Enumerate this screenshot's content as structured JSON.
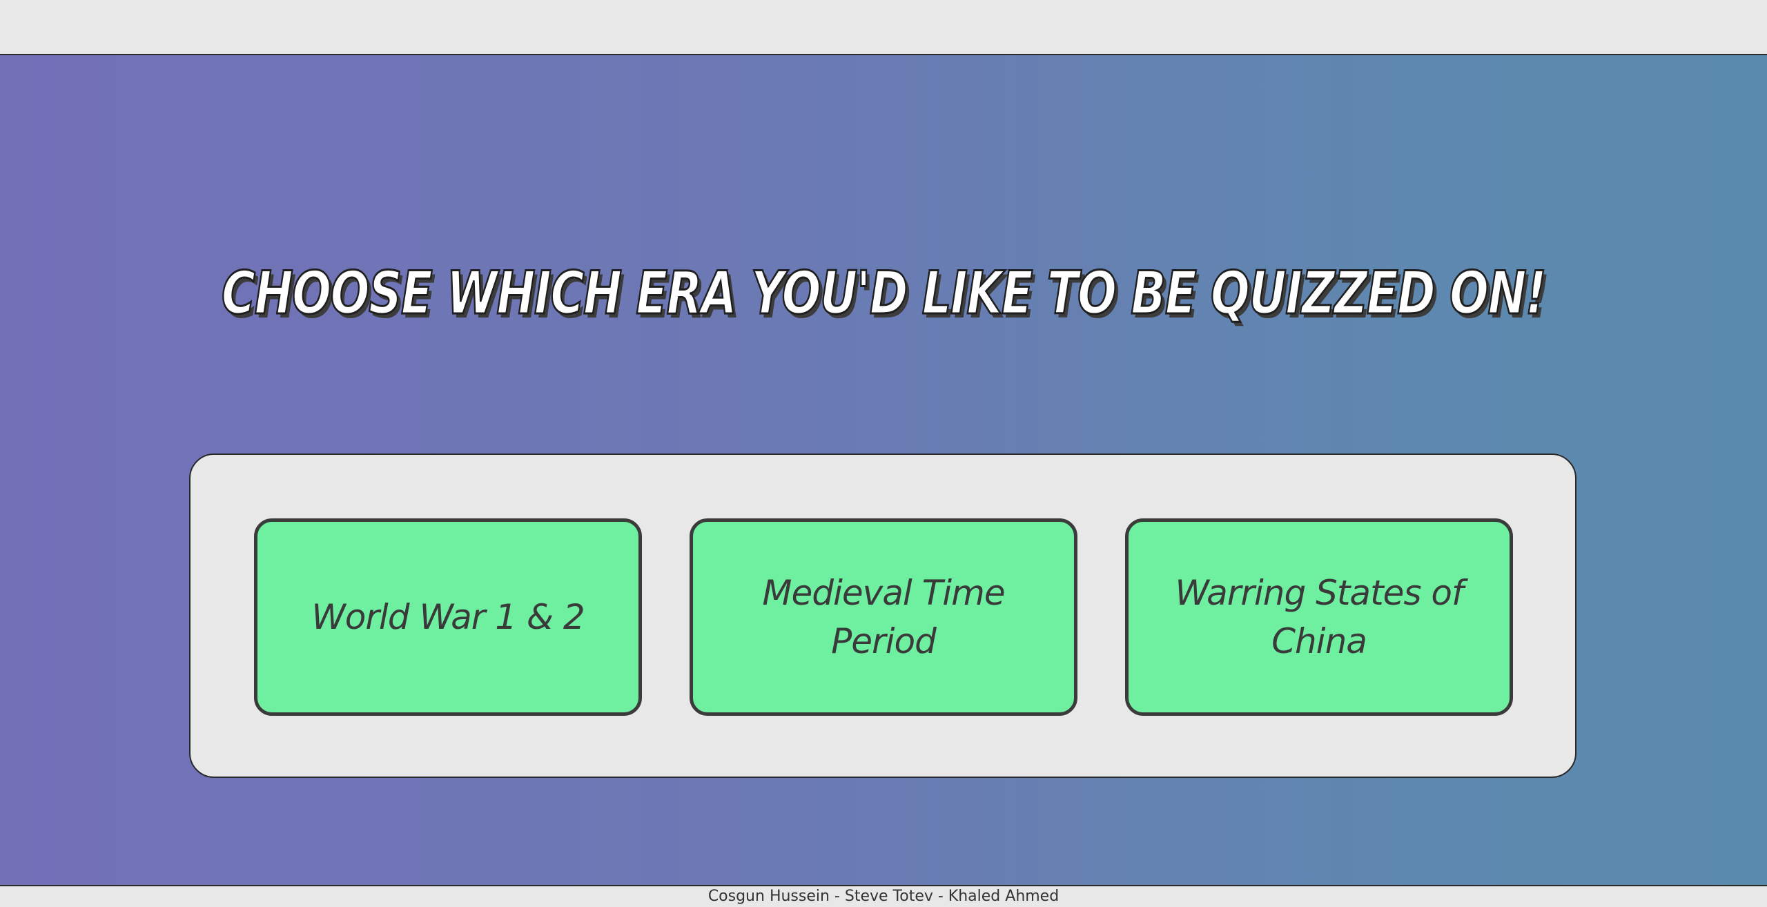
{
  "heading": "CHOOSE WHICH ERA YOU'D LIKE TO BE QUIZZED ON!",
  "eras": [
    {
      "label": "World War 1 & 2"
    },
    {
      "label": "Medieval Time Period"
    },
    {
      "label": "Warring States of China"
    }
  ],
  "footer": {
    "credits": "Cosgun Hussein - Steve Totev - Khaled Ahmed"
  },
  "colors": {
    "gradient_start": "#7370b8",
    "gradient_end": "#5a8bad",
    "button_fill": "#6ef0a0",
    "panel_fill": "#e8e8e8",
    "text_dark": "#3a3a3a"
  }
}
